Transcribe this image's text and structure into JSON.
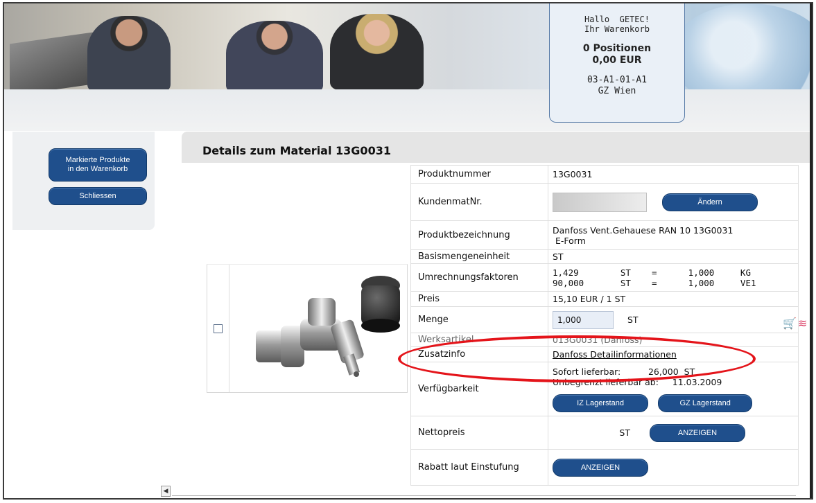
{
  "cart": {
    "greeting": "Hallo  GETEC!",
    "subtitle": "Ihr Warenkorb",
    "positions": "0 Positionen",
    "amount": "0,00 EUR",
    "code": "03-A1-01-A1",
    "branch": "GZ Wien"
  },
  "sidebar": {
    "mark_button_line1": "Markierte Produkte",
    "mark_button_line2": "in den Warenkorb",
    "close_button": "Schliessen"
  },
  "details": {
    "title": "Details zum Material 13G0031"
  },
  "rows": {
    "produktnummer_label": "Produktnummer",
    "produktnummer_value": "13G0031",
    "kundenmat_label": "KundenmatNr.",
    "aendern_button": "Ändern",
    "bezeichnung_label": "Produktbezeichnung",
    "bezeichnung_line1": "Danfoss Vent.Gehauese RAN 10 13G0031",
    "bezeichnung_line2": " E-Form",
    "basis_label": "Basismengeneinheit",
    "basis_value": "ST",
    "umrechnung_label": "Umrechnungsfaktoren",
    "umrechnung_line1": "1,429        ST    =      1,000     KG",
    "umrechnung_line2": "90,000       ST    =      1,000     VE1",
    "preis_label": "Preis",
    "preis_value": "15,10 EUR / 1 ST",
    "menge_label": "Menge",
    "menge_value": "1,000",
    "menge_unit": "ST",
    "werks_label": "Werksartikel",
    "werks_value": "013G0031 (Danfoss)",
    "zusatz_label": "Zusatzinfo",
    "zusatz_link": "Danfoss Detailinformationen",
    "verf_label": "Verfügbarkeit",
    "verf_line1": "Sofort lieferbar:          26,000  ST",
    "verf_line2": "Unbegrenzt lieferbar ab:     11.03.2009",
    "iz_button": "IZ Lagerstand",
    "gz_button": "GZ Lagerstand",
    "netto_label": "Nettopreis",
    "netto_unit": "ST",
    "netto_button": "ANZEIGEN",
    "rabatt_label": "Rabatt laut Einstufung",
    "rabatt_button": "ANZEIGEN"
  },
  "scrollbar": {
    "left_arrow": "◀"
  },
  "icons": {
    "cart": "cart-icon",
    "fire": "fire-icon"
  },
  "colors": {
    "button": "#1f4f8c",
    "highlight": "#e4141a"
  }
}
